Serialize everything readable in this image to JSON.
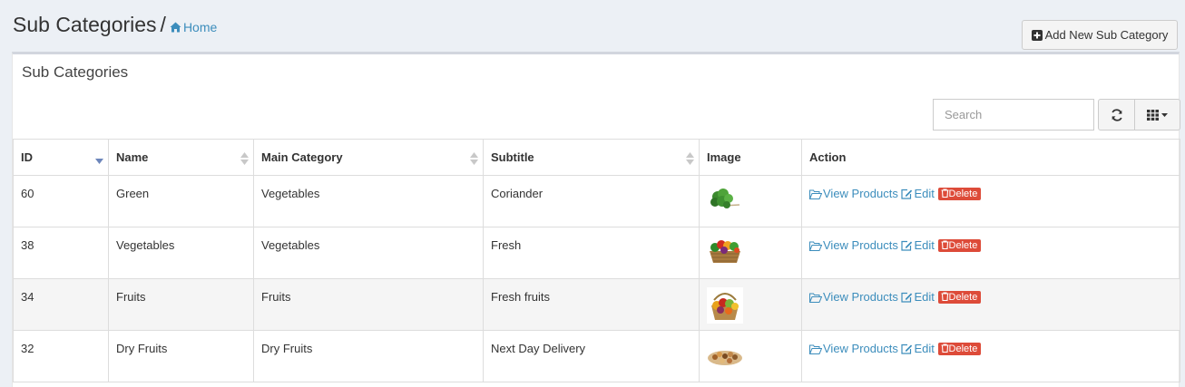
{
  "header": {
    "title": "Sub Categories",
    "separator": "/",
    "breadcrumb_home": "Home",
    "add_button_label": "Add New Sub Category"
  },
  "panel": {
    "title": "Sub Categories",
    "search_placeholder": "Search"
  },
  "table": {
    "columns": [
      "ID",
      "Name",
      "Main Category",
      "Subtitle",
      "Image",
      "Action"
    ],
    "sorted_column": "ID",
    "rows": [
      {
        "id": "60",
        "name": "Green",
        "main_category": "Vegetables",
        "subtitle": "Coriander",
        "image": "coriander-thumbnail"
      },
      {
        "id": "38",
        "name": "Vegetables",
        "main_category": "Vegetables",
        "subtitle": "Fresh",
        "image": "vegetable-basket-thumbnail"
      },
      {
        "id": "34",
        "name": "Fruits",
        "main_category": "Fruits",
        "subtitle": "Fresh fruits",
        "image": "fruit-basket-thumbnail"
      },
      {
        "id": "32",
        "name": "Dry Fruits",
        "main_category": "Dry Fruits",
        "subtitle": "Next Day Delivery",
        "image": "dry-fruits-thumbnail"
      }
    ],
    "actions": {
      "view": "View Products",
      "edit": "Edit",
      "delete": "Delete"
    }
  },
  "colors": {
    "link": "#3c8dbc",
    "danger": "#dd4b39",
    "page_bg": "#ecf0f5"
  }
}
